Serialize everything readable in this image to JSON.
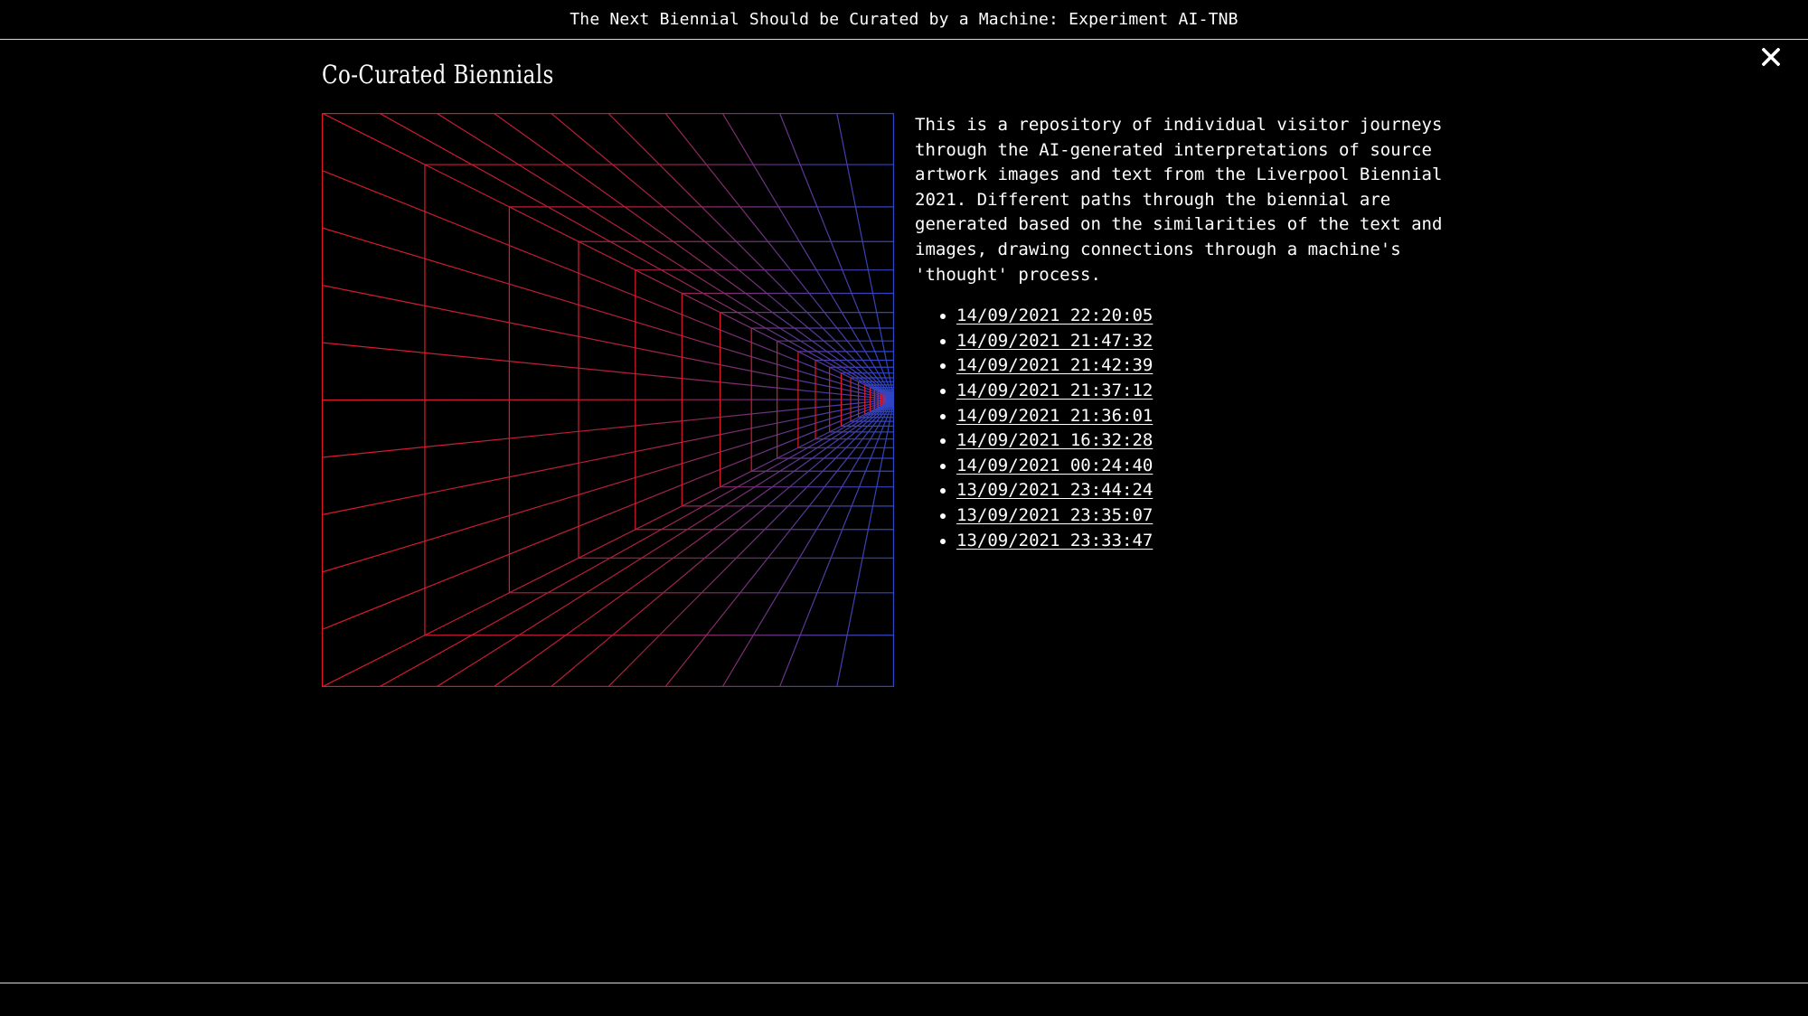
{
  "header": {
    "title": "The Next Biennial Should be Curated by a Machine: Experiment AI-TNB"
  },
  "close_button": {
    "icon": "close-icon",
    "glyph": "✕"
  },
  "main": {
    "title": "Co-Curated Biennials",
    "description": "This is a repository of individual visitor journeys through the AI-generated interpretations of source artwork images and text from the Liverpool Biennial 2021. Different paths through the biennial are generated based on the similarities of the text and images, drawing connections through a machine's 'thought' process.",
    "journeys": [
      "14/09/2021 22:20:05",
      "14/09/2021 21:47:32",
      "14/09/2021 21:42:39",
      "14/09/2021 21:37:12",
      "14/09/2021 21:36:01",
      "14/09/2021 16:32:28",
      "14/09/2021 00:24:40",
      "13/09/2021 23:44:24",
      "13/09/2021 23:35:07",
      "13/09/2021 23:33:47"
    ]
  },
  "colors": {
    "background": "#000000",
    "text": "#ffffff",
    "tunnel_red": "#e0192b",
    "tunnel_blue": "#2c46c8"
  }
}
